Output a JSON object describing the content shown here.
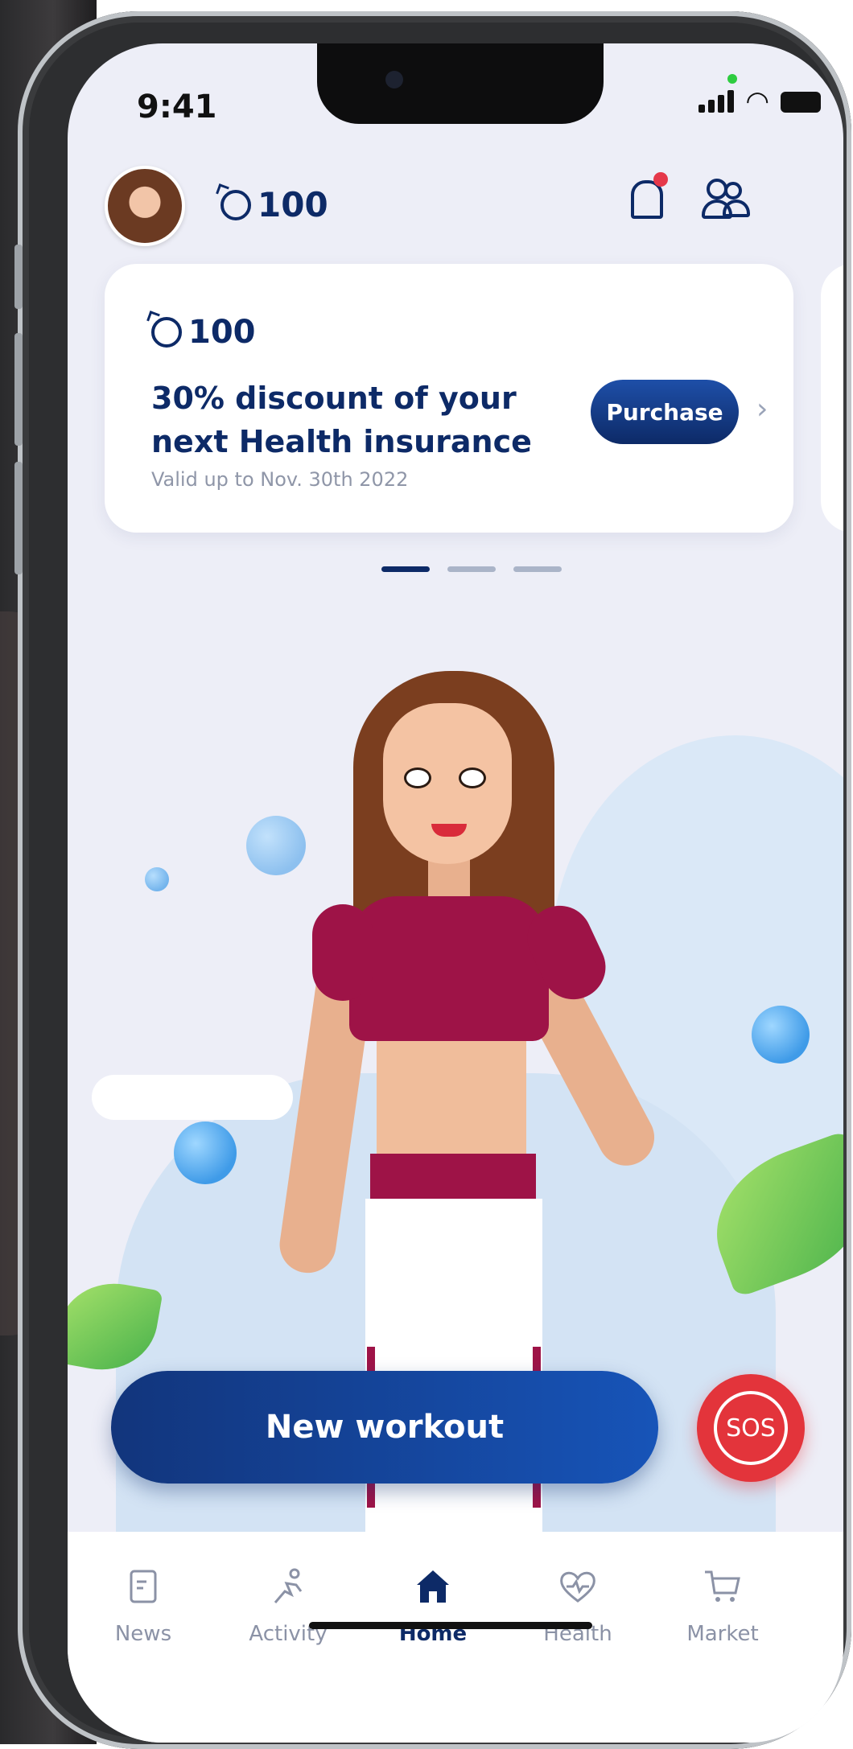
{
  "status_bar": {
    "time": "9:41"
  },
  "header": {
    "points": "100"
  },
  "promo_card": {
    "points": "100",
    "title": "30% discount of your next Health insurance",
    "validity": "Valid up to Nov. 30th 2022",
    "purchase_label": "Purchase",
    "chevron": "›"
  },
  "cta": {
    "workout_label": "New workout",
    "sos_label": "SOS"
  },
  "tabs": [
    {
      "label": "News",
      "icon": "news-icon"
    },
    {
      "label": "Activity",
      "icon": "running-icon"
    },
    {
      "label": "Home",
      "icon": "home-icon",
      "active": true
    },
    {
      "label": "Health",
      "icon": "heart-pulse-icon"
    },
    {
      "label": "Market",
      "icon": "cart-icon"
    }
  ],
  "colors": {
    "navy": "#0d2a67",
    "accent_blue": "#1754b8",
    "sos_red": "#e3343b",
    "notification": "#e5384a",
    "background": "#edeef7"
  }
}
